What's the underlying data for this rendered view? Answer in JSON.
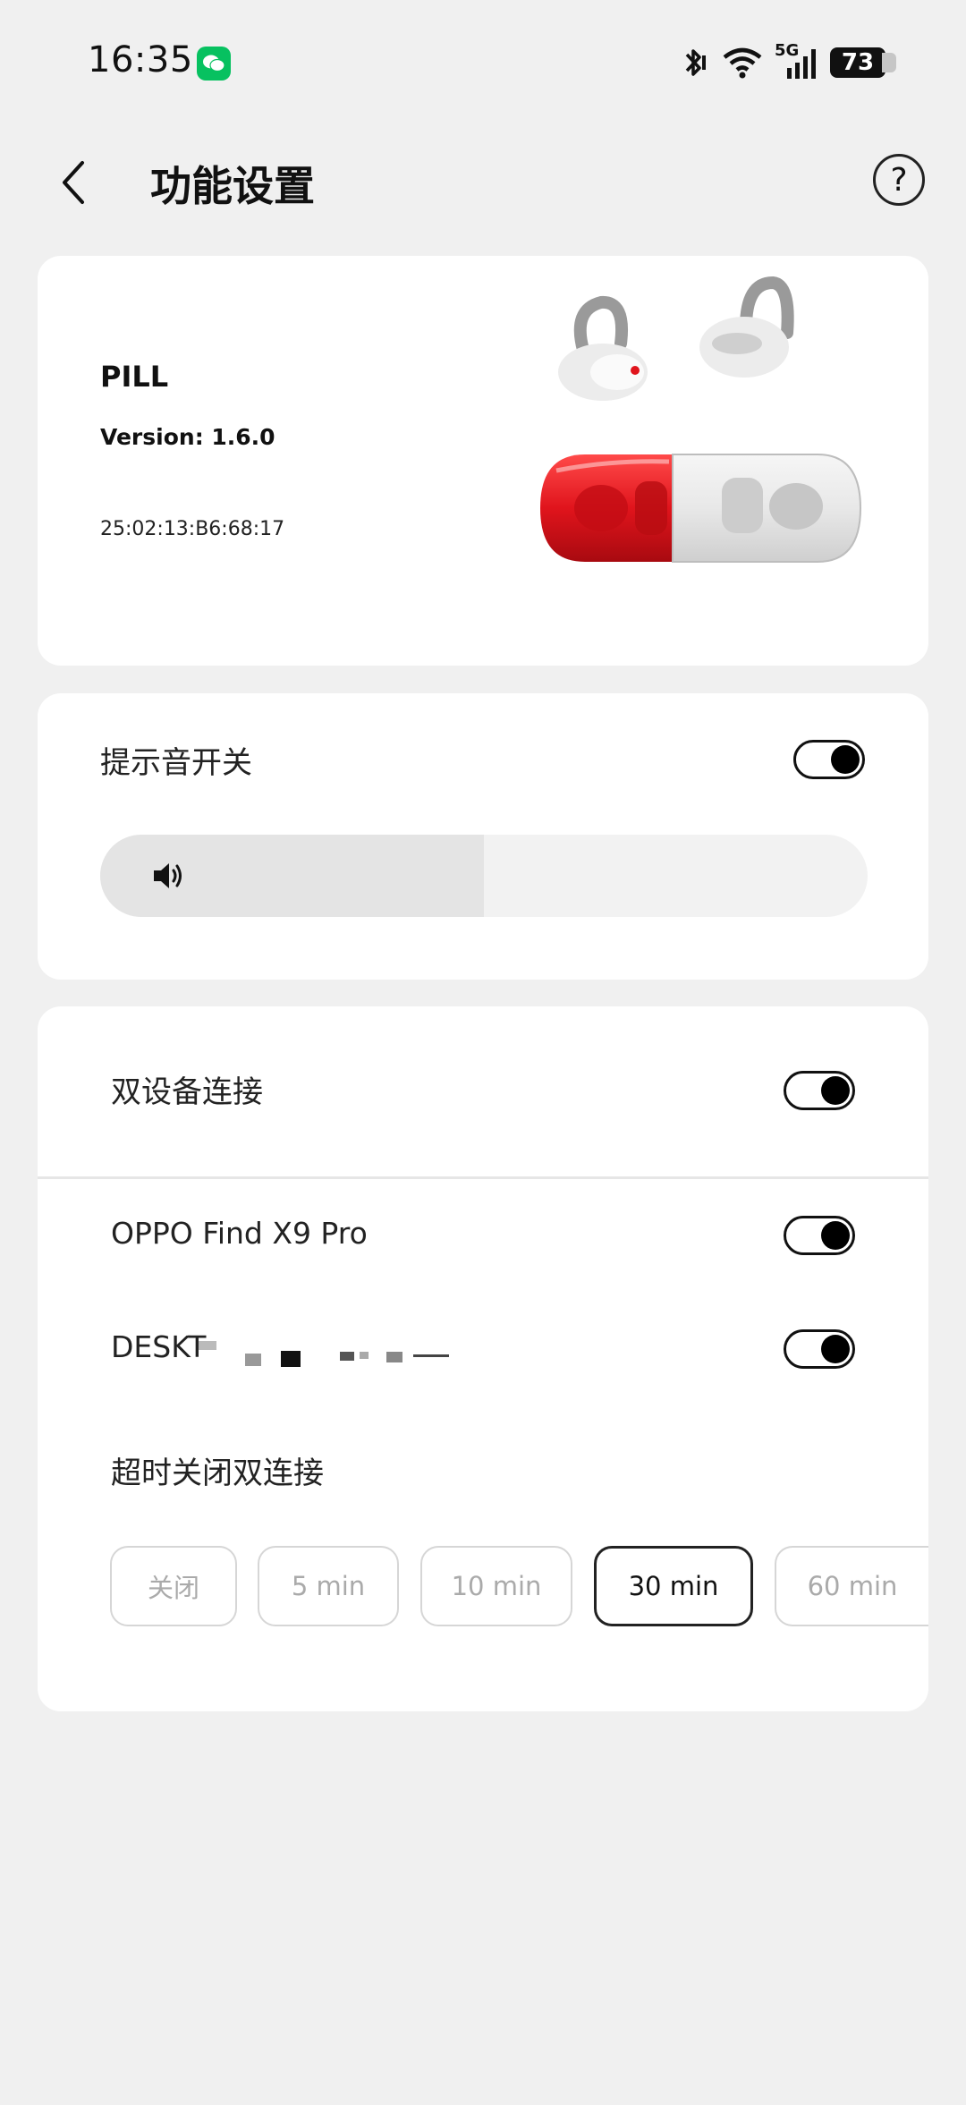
{
  "status_bar": {
    "time": "16:35",
    "battery": "73",
    "network": "5G"
  },
  "header": {
    "title": "功能设置",
    "help": "?"
  },
  "device": {
    "name": "PILL",
    "version": "Version: 1.6.0",
    "mac": "25:02:13:B6:68:17"
  },
  "prompt_sound": {
    "label": "提示音开关",
    "enabled": true,
    "volume": 0.5
  },
  "dual_connection": {
    "label": "双设备连接",
    "enabled": true,
    "devices": [
      {
        "name": "OPPO Find X9 Pro",
        "enabled": true
      },
      {
        "name": "DESKT",
        "enabled": true
      }
    ],
    "timeout_label": "超时关闭双连接",
    "timeout_options": [
      "关闭",
      "5 min",
      "10 min",
      "30 min",
      "60 min"
    ],
    "timeout_selected": "30 min"
  },
  "colors": {
    "accent": "#000000",
    "pill_red": "#e0141c",
    "background": "#f0f0f0"
  }
}
